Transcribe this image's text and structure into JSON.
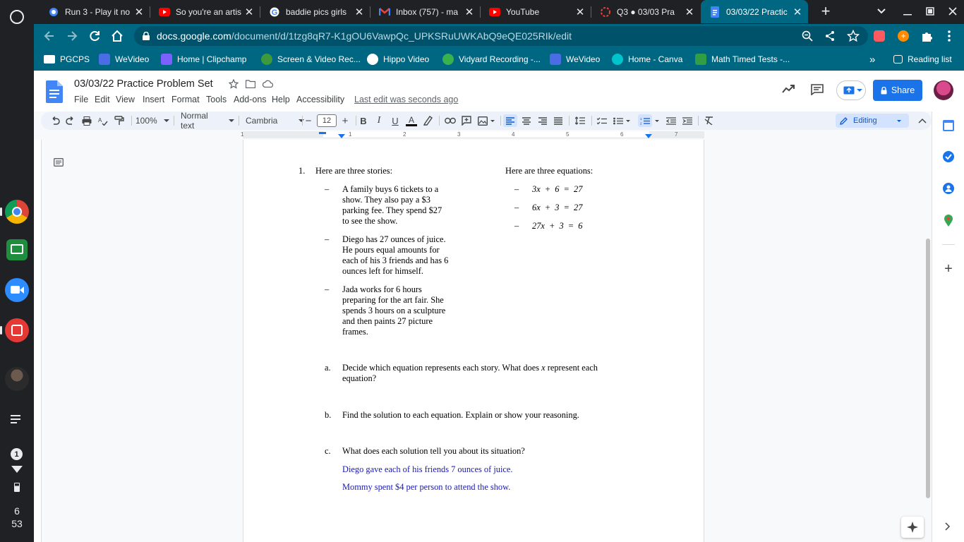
{
  "shelf": {
    "time_hour": "6",
    "time_min": "53",
    "notification_count": "1"
  },
  "tabs": [
    {
      "title": "Run 3 - Play it no",
      "icon": "poki-icon",
      "close": "✕"
    },
    {
      "title": "So you're an artis",
      "icon": "youtube-icon",
      "close": "✕"
    },
    {
      "title": "baddie pics girls",
      "icon": "google-icon",
      "close": "✕"
    },
    {
      "title": "Inbox (757) - ma",
      "icon": "gmail-icon",
      "close": "✕"
    },
    {
      "title": "YouTube",
      "icon": "youtube-icon",
      "close": "✕"
    },
    {
      "title": "Q3 ● 03/03 Pra",
      "icon": "loading-icon",
      "close": "✕"
    },
    {
      "title": "03/03/22 Practic",
      "icon": "docs-icon",
      "close": "✕"
    }
  ],
  "address": {
    "host": "docs.google.com",
    "path": "/document/d/1tzg8qR7-K1gOU6VawpQc_UPKSRuUWKAbQ9eQE025RIk/edit"
  },
  "bookmarks": [
    {
      "label": "PGCPS",
      "color": "#ffffff"
    },
    {
      "label": "WeVideo",
      "color": "#4a6de5"
    },
    {
      "label": "Home | Clipchamp",
      "color": "#7b61ff"
    },
    {
      "label": "Screen & Video Rec...",
      "color": "#3c9a3c"
    },
    {
      "label": "Hippo Video",
      "color": "#ffffff"
    },
    {
      "label": "Vidyard Recording -...",
      "color": "#37b24d"
    },
    {
      "label": "WeVideo",
      "color": "#4a6de5"
    },
    {
      "label": "Home - Canva",
      "color": "#00c4cc"
    },
    {
      "label": "Math Timed Tests -...",
      "color": "#2f9e44"
    }
  ],
  "bookmarks_more": "»",
  "reading_list": "Reading list",
  "doc": {
    "title": "03/03/22  Practice Problem Set",
    "menu": [
      "File",
      "Edit",
      "View",
      "Insert",
      "Format",
      "Tools",
      "Add-ons",
      "Help",
      "Accessibility"
    ],
    "last_edit": "Last edit was seconds ago",
    "share": "Share"
  },
  "format": {
    "zoom": "100%",
    "style": "Normal text",
    "font": "Cambria",
    "size": "12",
    "mode": "Editing"
  },
  "ruler": {
    "numbers": [
      "1",
      "1",
      "2",
      "3",
      "4",
      "5",
      "6",
      "7"
    ]
  },
  "content": {
    "item_number": "1.",
    "stories_heading": "Here are three stories:",
    "equations_heading": "Here are three equations:",
    "dash": "–",
    "story1": [
      "A family buys 6 tickets to a",
      "show. They also pay a $3",
      "parking fee. They spend $27",
      "to see the show."
    ],
    "story2": [
      "Diego has 27 ounces of juice.",
      "He pours equal amounts for",
      "each of his 3 friends and has 6",
      "ounces left for himself."
    ],
    "story3": [
      "Jada works for 6 hours",
      "preparing for the art fair. She",
      "spends 3 hours on a sculpture",
      "and then paints 27 picture",
      "frames."
    ],
    "equations": [
      "3x + 6 = 27",
      "6x + 3 = 27",
      "27x + 3 = 6"
    ],
    "qa_label": "a.",
    "qa_line1a": "Decide which equation represents each story. What does ",
    "qa_var": "x",
    "qa_line1b": " represent each",
    "qa_line2": "equation?",
    "qb_label": "b.",
    "qb_text": "Find the solution to each equation. Explain or show your reasoning.",
    "qc_label": "c.",
    "qc_text": "What does each solution tell you about its situation?",
    "answer1": "Diego gave each of his friends 7 ounces of juice.",
    "answer2": "Mommy spent $4 per person to attend the show."
  }
}
